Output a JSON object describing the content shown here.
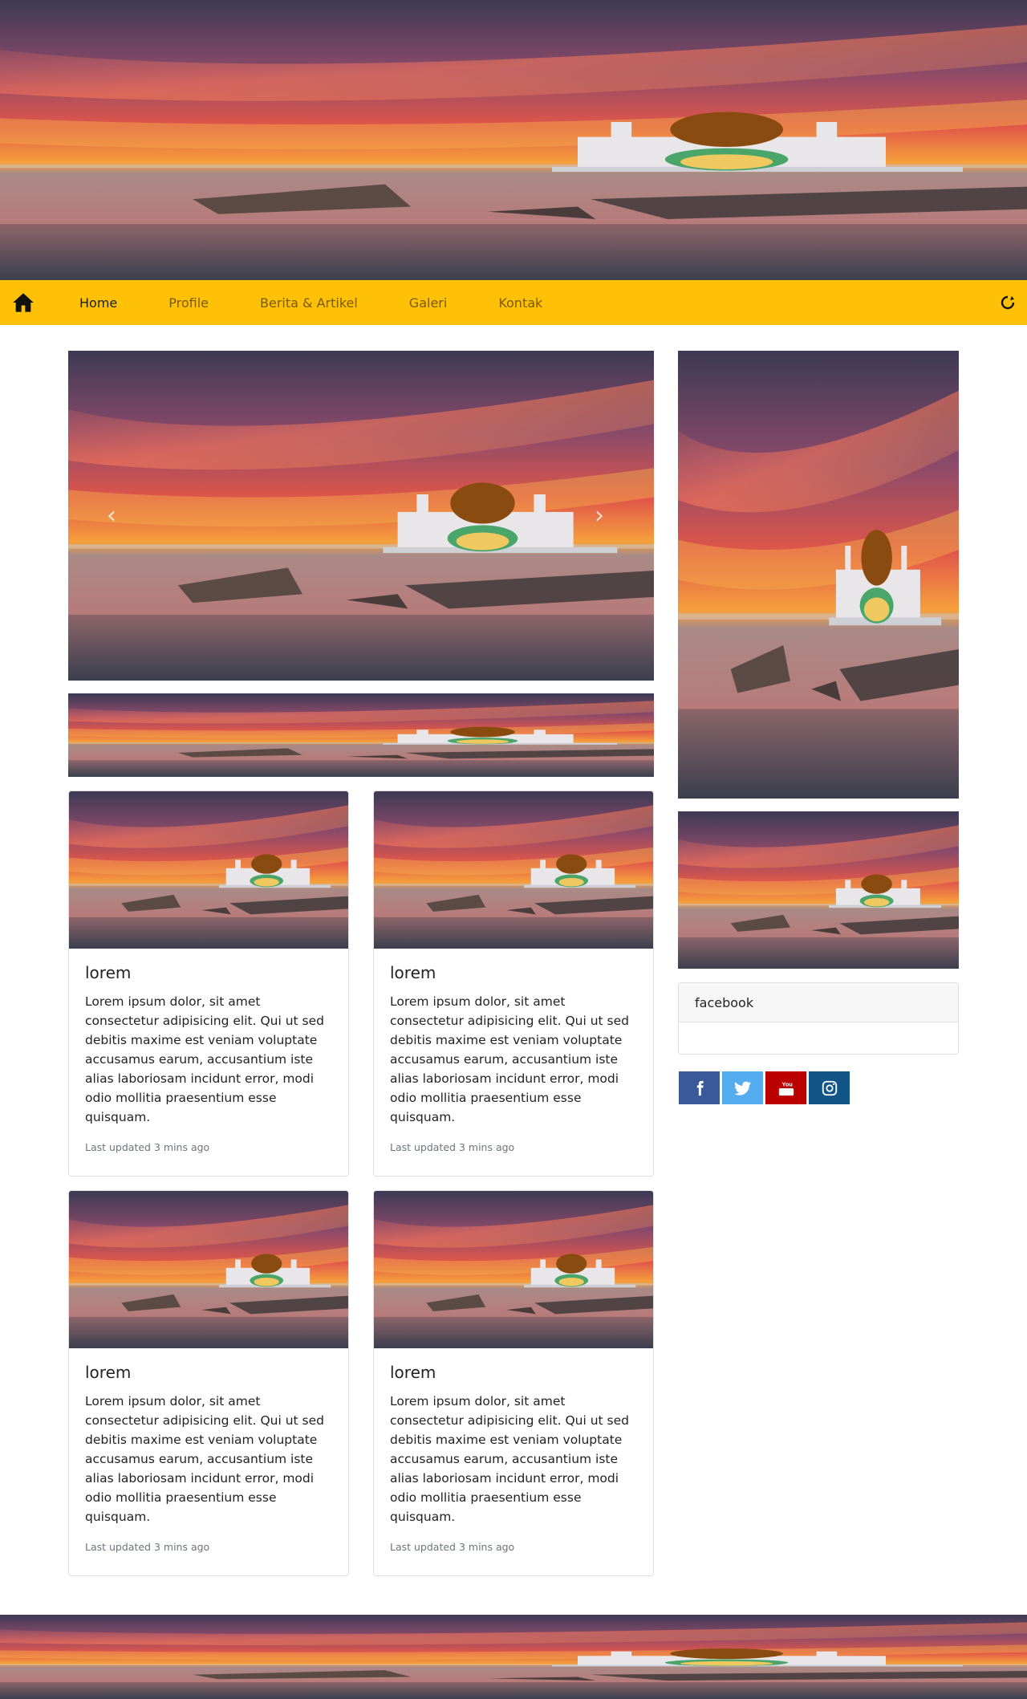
{
  "nav": {
    "home_icon": "home-icon",
    "links": [
      {
        "label": "Home",
        "active": true
      },
      {
        "label": "Profile",
        "active": false
      },
      {
        "label": "Berita & Artikel",
        "active": false
      },
      {
        "label": "Galeri",
        "active": false
      },
      {
        "label": "Kontak",
        "active": false
      }
    ],
    "right_icon": "refresh-icon"
  },
  "carousel": {
    "prev_glyph": "‹",
    "next_glyph": "›"
  },
  "cards": [
    {
      "title": "lorem",
      "text": "Lorem ipsum dolor, sit amet consectetur adipisicing elit. Qui ut sed debitis maxime est veniam voluptate accusamus earum, accusantium iste alias laboriosam incidunt error, modi odio mollitia praesentium esse quisquam.",
      "updated": "Last updated 3 mins ago"
    },
    {
      "title": "lorem",
      "text": "Lorem ipsum dolor, sit amet consectetur adipisicing elit. Qui ut sed debitis maxime est veniam voluptate accusamus earum, accusantium iste alias laboriosam incidunt error, modi odio mollitia praesentium esse quisquam.",
      "updated": "Last updated 3 mins ago"
    },
    {
      "title": "lorem",
      "text": "Lorem ipsum dolor, sit amet consectetur adipisicing elit. Qui ut sed debitis maxime est veniam voluptate accusamus earum, accusantium iste alias laboriosam incidunt error, modi odio mollitia praesentium esse quisquam.",
      "updated": "Last updated 3 mins ago"
    },
    {
      "title": "lorem",
      "text": "Lorem ipsum dolor, sit amet consectetur adipisicing elit. Qui ut sed debitis maxime est veniam voluptate accusamus earum, accusantium iste alias laboriosam incidunt error, modi odio mollitia praesentium esse quisquam.",
      "updated": "Last updated 3 mins ago"
    }
  ],
  "sidebar": {
    "facebook_title": "facebook",
    "social": [
      {
        "icon": "facebook-icon",
        "color": "#3b5998"
      },
      {
        "icon": "twitter-icon",
        "color": "#55acee"
      },
      {
        "icon": "youtube-icon",
        "color": "#bb0000"
      },
      {
        "icon": "instagram-icon",
        "color": "#125688"
      }
    ]
  },
  "colors": {
    "navbar": "#ffc107",
    "nav_active": "#222222",
    "nav_link": "#7a5b00"
  }
}
